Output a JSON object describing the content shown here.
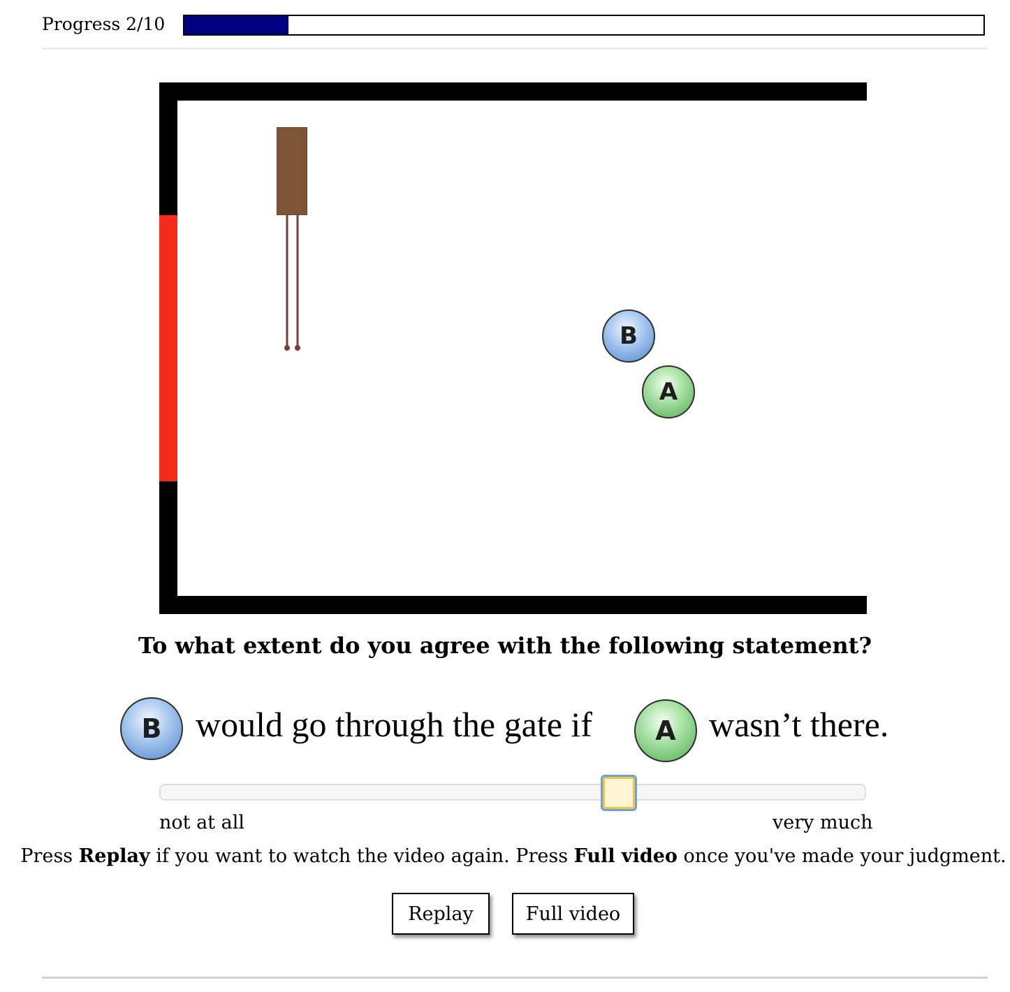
{
  "progress": {
    "label": "Progress 2/10",
    "current": 2,
    "total": 10,
    "fraction": 0.13,
    "fill_color": "#000080"
  },
  "scene": {
    "goal_color": "#f42a1a",
    "gate_color": "#7d5435",
    "gate_leg_color": "#7b3d33",
    "balls": {
      "b_label": "B",
      "a_label": "A"
    }
  },
  "question": {
    "prompt": "To what extent do you agree with the following statement?",
    "ball_b": "B",
    "part1": "would go through the gate if",
    "ball_a": "A",
    "part2": "wasn’t there."
  },
  "slider": {
    "value": 0.65,
    "min_label": "not at all",
    "max_label": "very much"
  },
  "instructions": {
    "pre": "Press ",
    "replay_word": "Replay",
    "mid": " if you want to watch the video again. Press ",
    "full_word": "Full video",
    "post": " once you've made your judgment."
  },
  "buttons": {
    "replay": "Replay",
    "full_video": "Full video"
  }
}
